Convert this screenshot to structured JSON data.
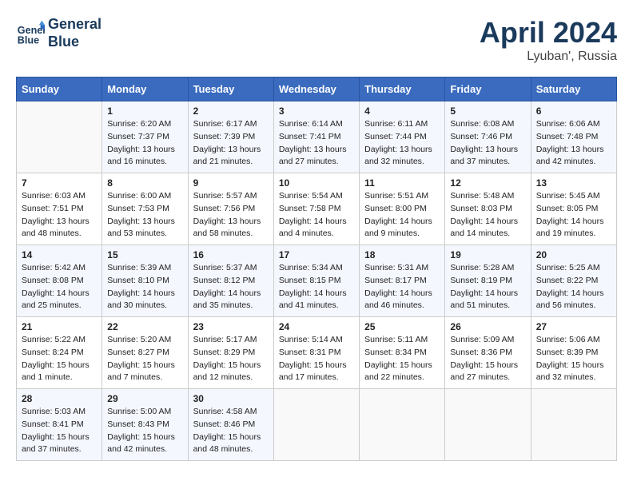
{
  "header": {
    "logo_line1": "General",
    "logo_line2": "Blue",
    "month_year": "April 2024",
    "location": "Lyuban', Russia"
  },
  "days_of_week": [
    "Sunday",
    "Monday",
    "Tuesday",
    "Wednesday",
    "Thursday",
    "Friday",
    "Saturday"
  ],
  "weeks": [
    [
      {
        "day": "",
        "sunrise": "",
        "sunset": "",
        "daylight": ""
      },
      {
        "day": "1",
        "sunrise": "Sunrise: 6:20 AM",
        "sunset": "Sunset: 7:37 PM",
        "daylight": "Daylight: 13 hours and 16 minutes."
      },
      {
        "day": "2",
        "sunrise": "Sunrise: 6:17 AM",
        "sunset": "Sunset: 7:39 PM",
        "daylight": "Daylight: 13 hours and 21 minutes."
      },
      {
        "day": "3",
        "sunrise": "Sunrise: 6:14 AM",
        "sunset": "Sunset: 7:41 PM",
        "daylight": "Daylight: 13 hours and 27 minutes."
      },
      {
        "day": "4",
        "sunrise": "Sunrise: 6:11 AM",
        "sunset": "Sunset: 7:44 PM",
        "daylight": "Daylight: 13 hours and 32 minutes."
      },
      {
        "day": "5",
        "sunrise": "Sunrise: 6:08 AM",
        "sunset": "Sunset: 7:46 PM",
        "daylight": "Daylight: 13 hours and 37 minutes."
      },
      {
        "day": "6",
        "sunrise": "Sunrise: 6:06 AM",
        "sunset": "Sunset: 7:48 PM",
        "daylight": "Daylight: 13 hours and 42 minutes."
      }
    ],
    [
      {
        "day": "7",
        "sunrise": "Sunrise: 6:03 AM",
        "sunset": "Sunset: 7:51 PM",
        "daylight": "Daylight: 13 hours and 48 minutes."
      },
      {
        "day": "8",
        "sunrise": "Sunrise: 6:00 AM",
        "sunset": "Sunset: 7:53 PM",
        "daylight": "Daylight: 13 hours and 53 minutes."
      },
      {
        "day": "9",
        "sunrise": "Sunrise: 5:57 AM",
        "sunset": "Sunset: 7:56 PM",
        "daylight": "Daylight: 13 hours and 58 minutes."
      },
      {
        "day": "10",
        "sunrise": "Sunrise: 5:54 AM",
        "sunset": "Sunset: 7:58 PM",
        "daylight": "Daylight: 14 hours and 4 minutes."
      },
      {
        "day": "11",
        "sunrise": "Sunrise: 5:51 AM",
        "sunset": "Sunset: 8:00 PM",
        "daylight": "Daylight: 14 hours and 9 minutes."
      },
      {
        "day": "12",
        "sunrise": "Sunrise: 5:48 AM",
        "sunset": "Sunset: 8:03 PM",
        "daylight": "Daylight: 14 hours and 14 minutes."
      },
      {
        "day": "13",
        "sunrise": "Sunrise: 5:45 AM",
        "sunset": "Sunset: 8:05 PM",
        "daylight": "Daylight: 14 hours and 19 minutes."
      }
    ],
    [
      {
        "day": "14",
        "sunrise": "Sunrise: 5:42 AM",
        "sunset": "Sunset: 8:08 PM",
        "daylight": "Daylight: 14 hours and 25 minutes."
      },
      {
        "day": "15",
        "sunrise": "Sunrise: 5:39 AM",
        "sunset": "Sunset: 8:10 PM",
        "daylight": "Daylight: 14 hours and 30 minutes."
      },
      {
        "day": "16",
        "sunrise": "Sunrise: 5:37 AM",
        "sunset": "Sunset: 8:12 PM",
        "daylight": "Daylight: 14 hours and 35 minutes."
      },
      {
        "day": "17",
        "sunrise": "Sunrise: 5:34 AM",
        "sunset": "Sunset: 8:15 PM",
        "daylight": "Daylight: 14 hours and 41 minutes."
      },
      {
        "day": "18",
        "sunrise": "Sunrise: 5:31 AM",
        "sunset": "Sunset: 8:17 PM",
        "daylight": "Daylight: 14 hours and 46 minutes."
      },
      {
        "day": "19",
        "sunrise": "Sunrise: 5:28 AM",
        "sunset": "Sunset: 8:19 PM",
        "daylight": "Daylight: 14 hours and 51 minutes."
      },
      {
        "day": "20",
        "sunrise": "Sunrise: 5:25 AM",
        "sunset": "Sunset: 8:22 PM",
        "daylight": "Daylight: 14 hours and 56 minutes."
      }
    ],
    [
      {
        "day": "21",
        "sunrise": "Sunrise: 5:22 AM",
        "sunset": "Sunset: 8:24 PM",
        "daylight": "Daylight: 15 hours and 1 minute."
      },
      {
        "day": "22",
        "sunrise": "Sunrise: 5:20 AM",
        "sunset": "Sunset: 8:27 PM",
        "daylight": "Daylight: 15 hours and 7 minutes."
      },
      {
        "day": "23",
        "sunrise": "Sunrise: 5:17 AM",
        "sunset": "Sunset: 8:29 PM",
        "daylight": "Daylight: 15 hours and 12 minutes."
      },
      {
        "day": "24",
        "sunrise": "Sunrise: 5:14 AM",
        "sunset": "Sunset: 8:31 PM",
        "daylight": "Daylight: 15 hours and 17 minutes."
      },
      {
        "day": "25",
        "sunrise": "Sunrise: 5:11 AM",
        "sunset": "Sunset: 8:34 PM",
        "daylight": "Daylight: 15 hours and 22 minutes."
      },
      {
        "day": "26",
        "sunrise": "Sunrise: 5:09 AM",
        "sunset": "Sunset: 8:36 PM",
        "daylight": "Daylight: 15 hours and 27 minutes."
      },
      {
        "day": "27",
        "sunrise": "Sunrise: 5:06 AM",
        "sunset": "Sunset: 8:39 PM",
        "daylight": "Daylight: 15 hours and 32 minutes."
      }
    ],
    [
      {
        "day": "28",
        "sunrise": "Sunrise: 5:03 AM",
        "sunset": "Sunset: 8:41 PM",
        "daylight": "Daylight: 15 hours and 37 minutes."
      },
      {
        "day": "29",
        "sunrise": "Sunrise: 5:00 AM",
        "sunset": "Sunset: 8:43 PM",
        "daylight": "Daylight: 15 hours and 42 minutes."
      },
      {
        "day": "30",
        "sunrise": "Sunrise: 4:58 AM",
        "sunset": "Sunset: 8:46 PM",
        "daylight": "Daylight: 15 hours and 48 minutes."
      },
      {
        "day": "",
        "sunrise": "",
        "sunset": "",
        "daylight": ""
      },
      {
        "day": "",
        "sunrise": "",
        "sunset": "",
        "daylight": ""
      },
      {
        "day": "",
        "sunrise": "",
        "sunset": "",
        "daylight": ""
      },
      {
        "day": "",
        "sunrise": "",
        "sunset": "",
        "daylight": ""
      }
    ]
  ]
}
